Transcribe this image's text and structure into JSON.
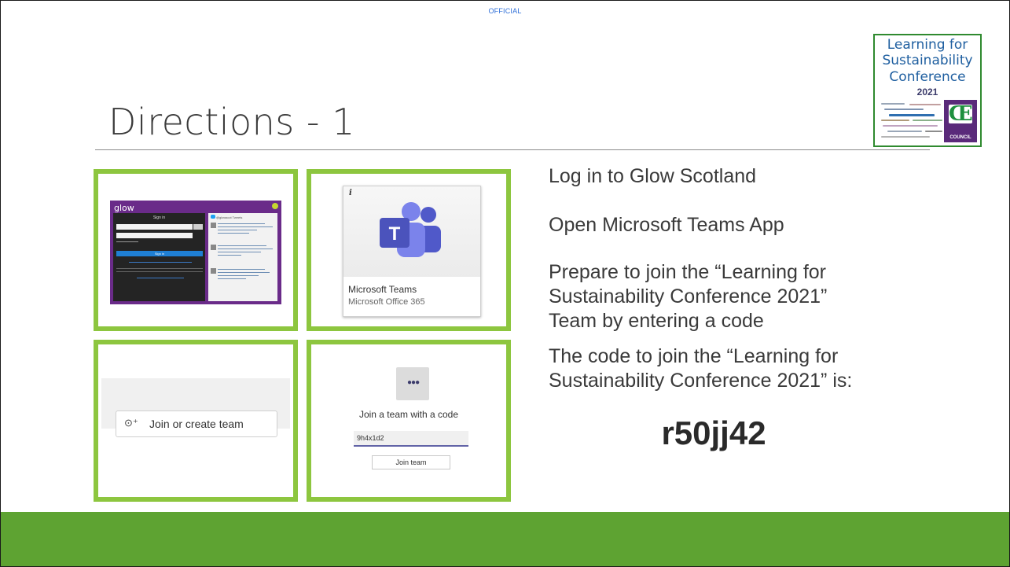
{
  "header": {
    "classification": "OFFICIAL"
  },
  "slide": {
    "title": "Directions  - 1"
  },
  "logo": {
    "line1": "Learning for",
    "line2": "Sustainability",
    "line3": "Conference",
    "year": "2021",
    "council": "COUNCIL"
  },
  "glow_panel": {
    "brand": "glow",
    "signin_title": "Sign in",
    "signin_button": "Sign in",
    "tweets_header": "@glowscot Tweets"
  },
  "teams_panel": {
    "name": "Microsoft Teams",
    "subtitle": "Microsoft Office 365",
    "info": "i"
  },
  "join_create_panel": {
    "button_label": "Join or create team"
  },
  "join_code_panel": {
    "title": "Join a team with a code",
    "code_value": "9h4x1d2",
    "button_label": "Join team"
  },
  "steps": [
    "Log in to Glow Scotland",
    "Open Microsoft Teams App",
    "Prepare to join the “Learning for Sustainability Conference 2021” Team by entering a code",
    "The code to join the “Learning for Sustainability Conference 2021” is:"
  ],
  "team_code": "r50jj42",
  "colors": {
    "accent_green": "#8dc63f",
    "footer_green": "#5ea332",
    "teams_purple": "#6264a7"
  }
}
